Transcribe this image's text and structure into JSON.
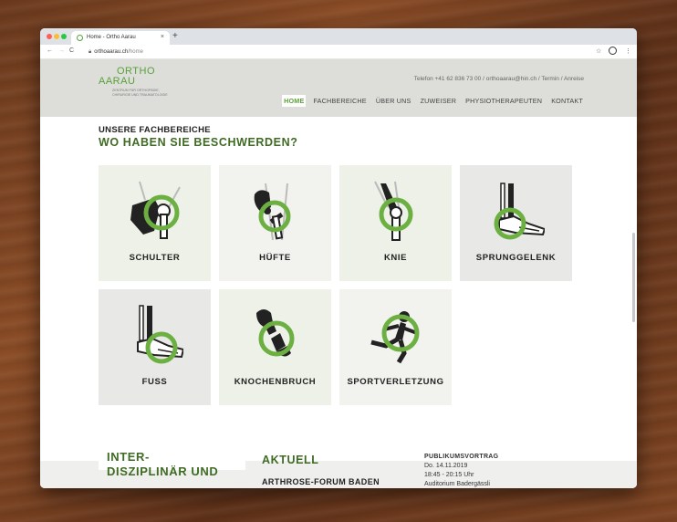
{
  "browser": {
    "tab_title": "Home - Ortho Aarau",
    "tab_close": "×",
    "new_tab": "+",
    "url_host": "orthoaarau.ch",
    "url_path": "/home",
    "back": "←",
    "forward": "→",
    "reload": "C",
    "star": "☆",
    "menu": "⋮"
  },
  "site": {
    "logo_line1": "ORTHO",
    "logo_line2": "AARAU",
    "logo_tagline": "ZENTRUM FÜR ORTHOPÄDIE, CHIRURGIE UND TRAUMATOLOGIE",
    "contact": "Telefon +41 62 836 73 00  /  orthoaarau@hin.ch  /  Termin  /  Anreise",
    "nav": [
      "HOME",
      "FACHBEREICHE",
      "ÜBER UNS",
      "ZUWEISER",
      "PHYSIOTHERAPEUTEN",
      "KONTAKT"
    ],
    "accent": "#5aa13a",
    "dark_green": "#3f6b24"
  },
  "section": {
    "kicker": "UNSERE FACHBEREICHE",
    "title": "WO HABEN SIE BESCHWERDEN?"
  },
  "tiles": [
    {
      "label": "SCHULTER",
      "icon": "shoulder-icon"
    },
    {
      "label": "HÜFTE",
      "icon": "hip-icon"
    },
    {
      "label": "KNIE",
      "icon": "knee-icon"
    },
    {
      "label": "SPRUNGGELENK",
      "icon": "ankle-icon"
    },
    {
      "label": "FUSS",
      "icon": "foot-icon"
    },
    {
      "label": "KNOCHENBRUCH",
      "icon": "fracture-icon"
    },
    {
      "label": "SPORTVERLETZUNG",
      "icon": "runner-icon"
    }
  ],
  "footer": {
    "inter_line1": "INTER-",
    "inter_line2": "DISZIPLINÄR UND",
    "aktuell": "AKTUELL",
    "arthrose": "ARTHROSE-FORUM BADEN",
    "publikum_heading": "PUBLIKUMSVORTRAG",
    "publikum_date": "Do. 14.11.2019",
    "publikum_time": "18:45 - 20:15 Uhr",
    "publikum_place": "Auditorium Badergässli"
  }
}
